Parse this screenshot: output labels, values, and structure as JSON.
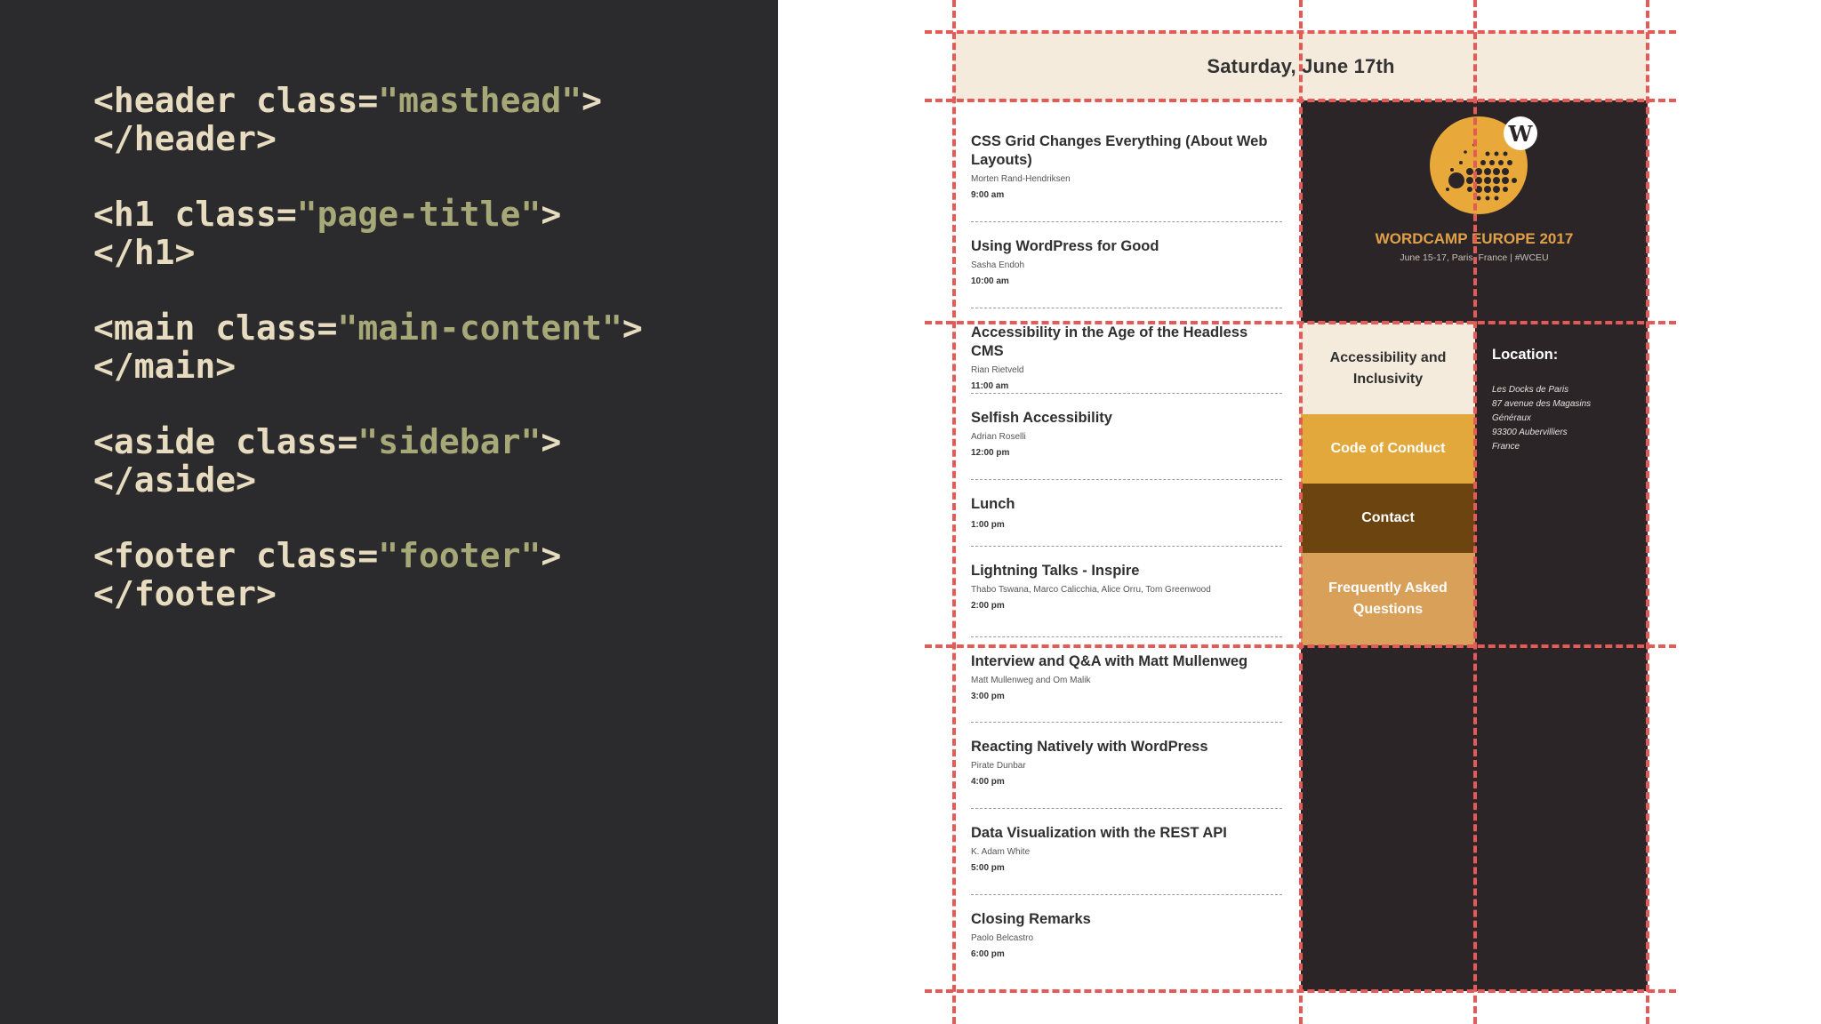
{
  "code": [
    {
      "open_pre": "<header class=",
      "open_str": "\"masthead\"",
      "open_post": ">",
      "close": "</header>"
    },
    {
      "open_pre": "<h1 class=",
      "open_str": "\"page-title\"",
      "open_post": ">",
      "close": "</h1>"
    },
    {
      "open_pre": "<main class=",
      "open_str": "\"main-content\"",
      "open_post": ">",
      "close": "</main>"
    },
    {
      "open_pre": "<aside class=",
      "open_str": "\"sidebar\"",
      "open_post": ">",
      "close": "</aside>"
    },
    {
      "open_pre": "<footer class=",
      "open_str": "\"footer\"",
      "open_post": ">",
      "close": "</footer>"
    }
  ],
  "masthead": {
    "title": "Saturday, June 17th"
  },
  "sessions": [
    {
      "title": "CSS Grid Changes Everything (About Web Layouts)",
      "speaker": "Morten Rand-Hendriksen",
      "time": "9:00 am"
    },
    {
      "title": "Using WordPress for Good",
      "speaker": "Sasha Endoh",
      "time": "10:00 am"
    },
    {
      "title": "Accessibility in the Age of the Headless CMS",
      "speaker": "Rian Rietveld",
      "time": "11:00 am"
    },
    {
      "title": "Selfish Accessibility",
      "speaker": "Adrian Roselli",
      "time": "12:00 pm"
    },
    {
      "title": "Lunch",
      "speaker": "",
      "time": "1:00 pm"
    },
    {
      "title": "Lightning Talks - Inspire",
      "speaker": "Thabo Tswana, Marco Calicchia, Alice Orru, Tom Greenwood",
      "time": "2:00 pm"
    },
    {
      "title": "Interview and Q&A with Matt Mullenweg",
      "speaker": "Matt Mullenweg and Om Malik",
      "time": "3:00 pm"
    },
    {
      "title": "Reacting Natively with WordPress",
      "speaker": "Pirate Dunbar",
      "time": "4:00 pm"
    },
    {
      "title": "Data Visualization with the REST API",
      "speaker": "K. Adam White",
      "time": "5:00 pm"
    },
    {
      "title": "Closing Remarks",
      "speaker": "Paolo Belcastro",
      "time": "6:00 pm"
    }
  ],
  "logo": {
    "title": "WORDCAMP EUROPE 2017",
    "subtitle": "June 15-17, Paris, France | #WCEU",
    "badge": "W"
  },
  "nav": [
    {
      "label": "Accessibility and Inclusivity",
      "bg": "#f5ebdc",
      "color": "#2f2f2f"
    },
    {
      "label": "Code of Conduct",
      "bg": "#e3a83b",
      "color": "#ffffff"
    },
    {
      "label": "Contact",
      "bg": "#6b4410",
      "color": "#ffffff"
    },
    {
      "label": "Frequently Asked Questions",
      "bg": "#d9a05a",
      "color": "#ffffff"
    }
  ],
  "location": {
    "title": "Location:",
    "lines": [
      "Les Docks de Paris",
      "87 avenue des Magasins",
      "Généraux",
      "93300 Aubervilliers",
      "France"
    ]
  }
}
